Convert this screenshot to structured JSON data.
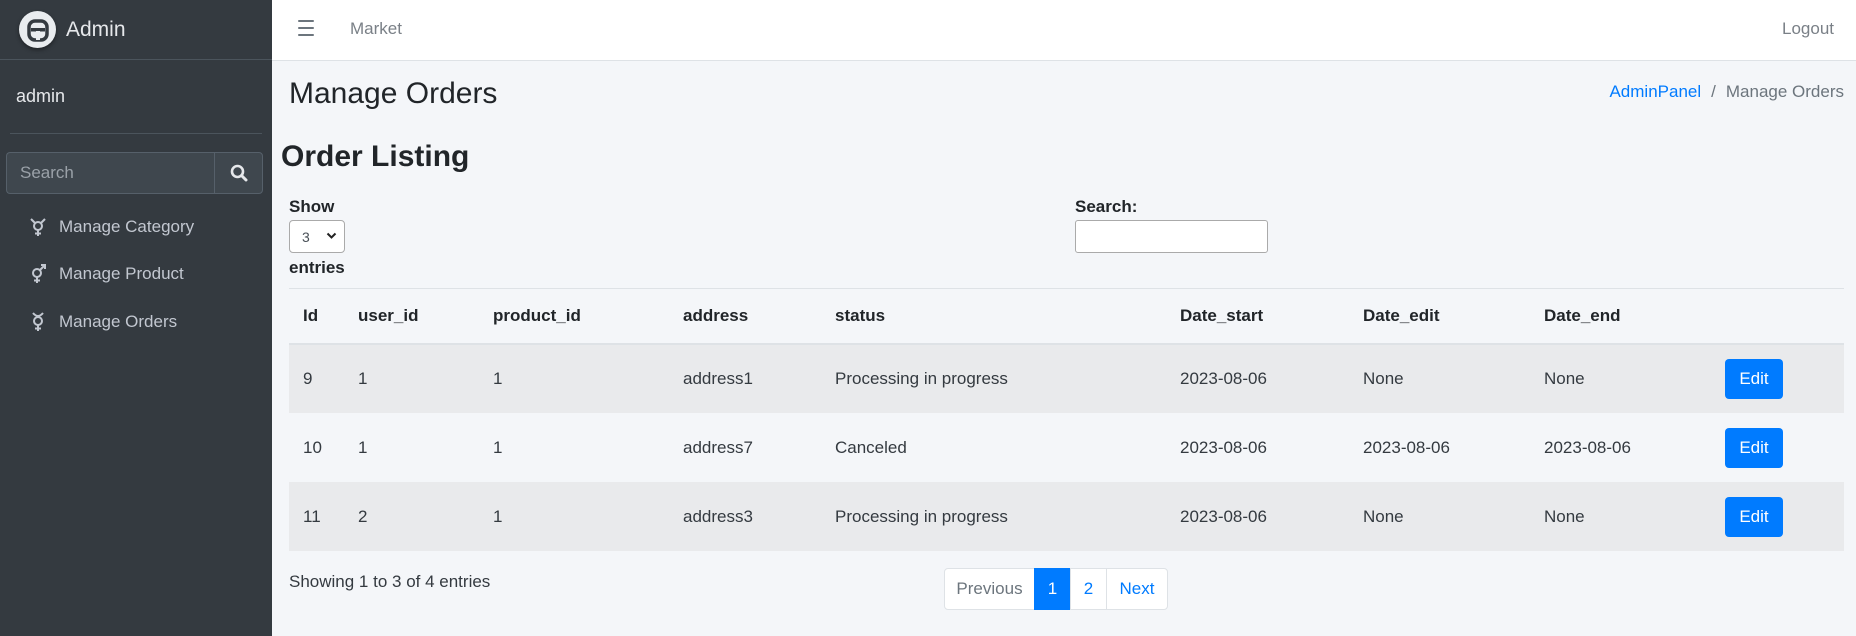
{
  "sidebar": {
    "brand": "Admin",
    "user": "admin",
    "search_placeholder": "Search",
    "items": [
      {
        "label": "Manage Category",
        "icon": "transgender-icon"
      },
      {
        "label": "Manage Product",
        "icon": "venus-mars-icon"
      },
      {
        "label": "Manage Orders",
        "icon": "mercury-icon"
      }
    ]
  },
  "topbar": {
    "market": "Market",
    "logout": "Logout"
  },
  "page": {
    "title": "Manage Orders",
    "breadcrumb": {
      "home": "AdminPanel",
      "separator": "/",
      "current": "Manage Orders"
    },
    "section_title": "Order Listing"
  },
  "controls": {
    "show_label": "Show",
    "show_value": "3",
    "entries_label": "entries",
    "search_label": "Search:"
  },
  "table": {
    "headers": [
      "Id",
      "user_id",
      "product_id",
      "address",
      "status",
      "Date_start",
      "Date_edit",
      "Date_end",
      ""
    ],
    "rows": [
      [
        "9",
        "1",
        "1",
        "address1",
        "Processing in progress",
        "2023-08-06",
        "None",
        "None"
      ],
      [
        "10",
        "1",
        "1",
        "address7",
        "Canceled",
        "2023-08-06",
        "2023-08-06",
        "2023-08-06"
      ],
      [
        "11",
        "2",
        "1",
        "address3",
        "Processing in progress",
        "2023-08-06",
        "None",
        "None"
      ]
    ],
    "action_label": "Edit"
  },
  "footer": {
    "showing": "Showing 1 to 3 of 4 entries",
    "pagination": {
      "previous": "Previous",
      "pages": [
        "1",
        "2"
      ],
      "current": "1",
      "next": "Next"
    }
  },
  "colors": {
    "primary": "#007bff",
    "sidebar_bg": "#343a40",
    "content_bg": "#f4f6f9"
  }
}
